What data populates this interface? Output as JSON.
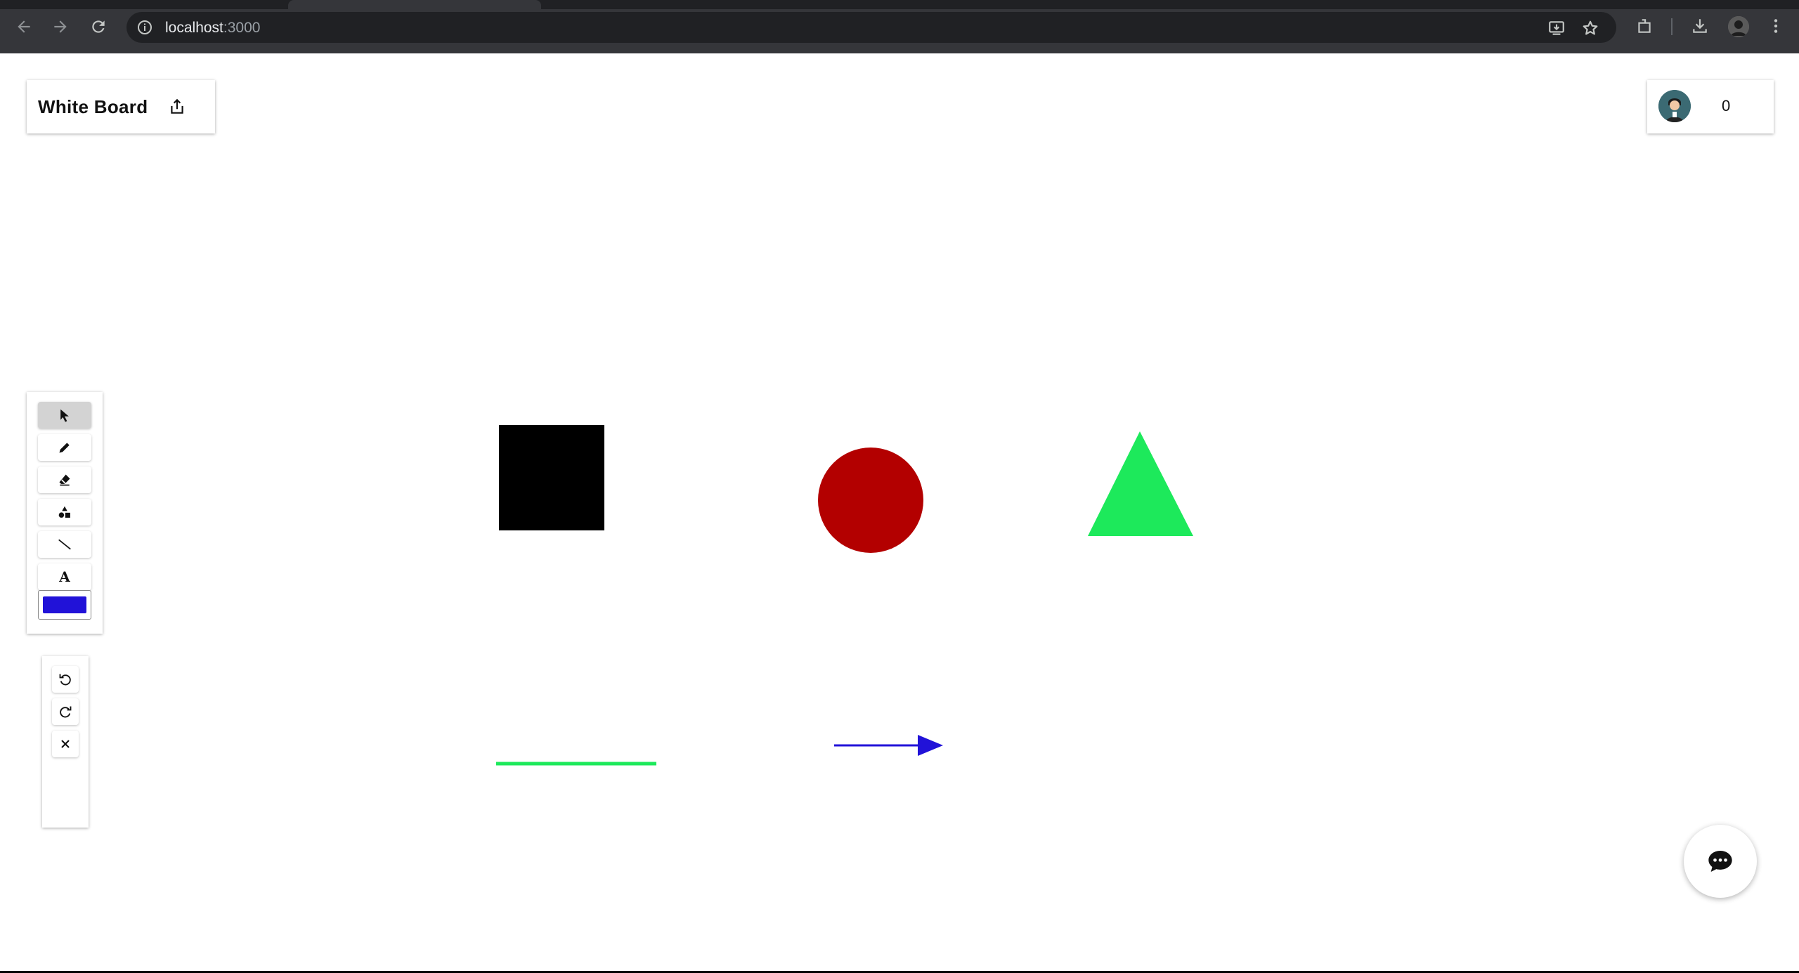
{
  "browser": {
    "url_host": "localhost",
    "url_port": ":3000"
  },
  "header": {
    "title": "White Board"
  },
  "users": {
    "count": "0"
  },
  "toolbar": {
    "tools": [
      "select",
      "pencil",
      "eraser",
      "shapes",
      "line",
      "text"
    ],
    "active_tool": "select",
    "text_tool_label": "A",
    "current_color": "#2112d8"
  },
  "canvas": {
    "shapes": [
      {
        "kind": "square",
        "color": "#000000"
      },
      {
        "kind": "circle",
        "color": "#b30000"
      },
      {
        "kind": "triangle",
        "color": "#1de95b"
      },
      {
        "kind": "line",
        "color": "#1de95b"
      },
      {
        "kind": "arrow",
        "color": "#2112d8"
      }
    ]
  },
  "icons": {
    "share": "share-icon",
    "chat": "chat-icon",
    "undo": "undo-icon",
    "redo": "redo-icon",
    "clear": "close-icon"
  }
}
